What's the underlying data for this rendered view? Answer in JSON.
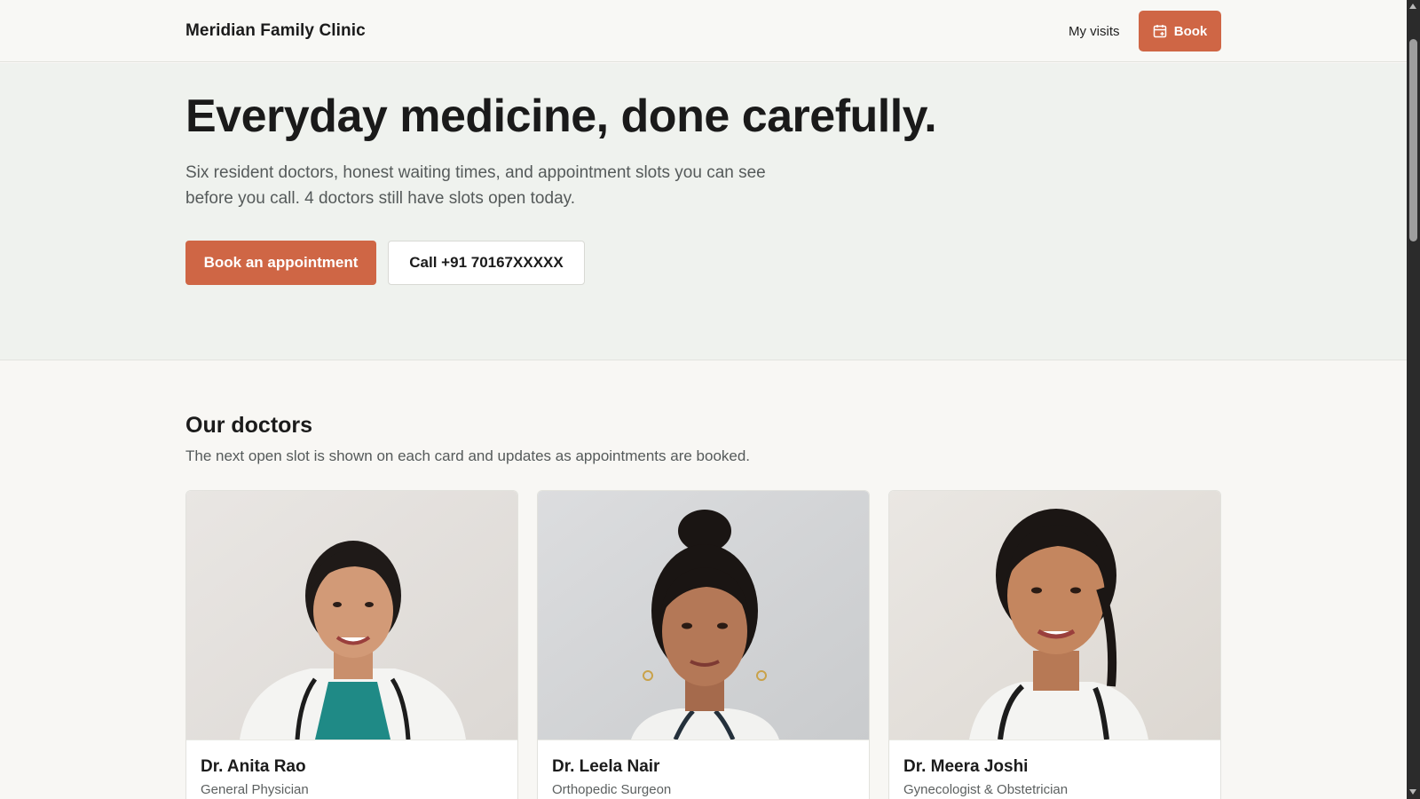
{
  "header": {
    "brand": "Meridian Family Clinic",
    "my_visits_label": "My visits",
    "book_label": "Book",
    "book_icon": "calendar-icon"
  },
  "hero": {
    "title": "Everyday medicine, done carefully.",
    "description": "Six resident doctors, honest waiting times, and appointment slots you can see before you call. 4 doctors still have slots open today.",
    "primary_cta": "Book an appointment",
    "secondary_cta": "Call +91 70167XXXXX"
  },
  "doctors_section": {
    "title": "Our doctors",
    "subtitle": "The next open slot is shown on each card and updates as appointments are booked.",
    "cards": [
      {
        "name": "Dr. Anita Rao",
        "specialty": "General Physician"
      },
      {
        "name": "Dr. Leela Nair",
        "specialty": "Orthopedic Surgeon"
      },
      {
        "name": "Dr. Meera Joshi",
        "specialty": "Gynecologist & Obstetrician"
      }
    ]
  },
  "colors": {
    "accent": "#cf6645",
    "hero_bg": "#eff2ee",
    "page_bg": "#f8f7f4"
  }
}
